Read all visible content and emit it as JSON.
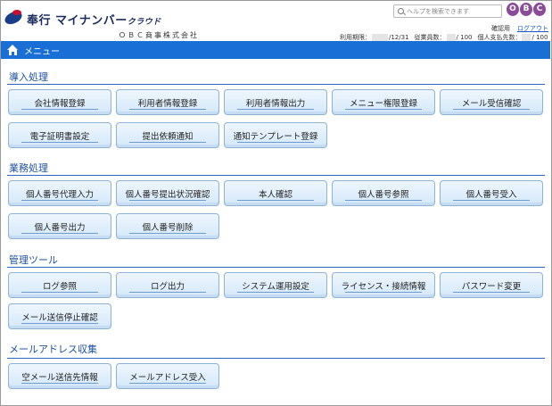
{
  "app": {
    "brand_main": "奉行 マイナンバー",
    "brand_sub": "クラウド",
    "company": "ＯＢＣ商事株式会社"
  },
  "header": {
    "help_placeholder": "ヘルプを検索できます",
    "obc_letters": [
      "O",
      "B",
      "C"
    ],
    "user_name": "確認用",
    "logout": "ログアウト",
    "status": {
      "period_label": "利用期限：",
      "period_value": "/12/31",
      "employees_label": "従業員数：",
      "employees_value": "/ 100",
      "payees_label": "個人支払先数：",
      "payees_value": "/ 100"
    }
  },
  "menubar": {
    "title": "メニュー"
  },
  "sections": [
    {
      "title": "導入処理",
      "buttons": [
        "会社情報登録",
        "利用者情報登録",
        "利用者情報出力",
        "メニュー権限登録",
        "メール受信確認",
        "電子証明書設定",
        "提出依頼通知",
        "通知テンプレート登録"
      ]
    },
    {
      "title": "業務処理",
      "buttons": [
        "個人番号代理入力",
        "個人番号提出状況確認",
        "本人確認",
        "個人番号参照",
        "個人番号受入",
        "個人番号出力",
        "個人番号削除"
      ]
    },
    {
      "title": "管理ツール",
      "buttons": [
        "ログ参照",
        "ログ出力",
        "システム運用設定",
        "ライセンス・接続情報",
        "パスワード変更",
        "メール送信停止確認"
      ]
    },
    {
      "title": "メールアドレス収集",
      "buttons": [
        "空メール送信先情報",
        "メールアドレス受入"
      ]
    }
  ],
  "colors": {
    "menubar": "#1a6fd6",
    "section_title": "#1d4f9e",
    "button_bg": "#d4e8fa"
  }
}
